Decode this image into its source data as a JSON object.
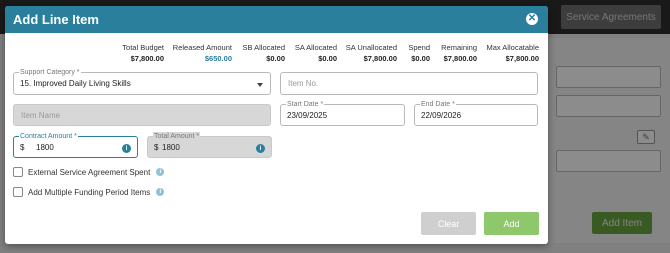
{
  "background": {
    "service_agreements_label": "Service Agreements",
    "add_item_label": "Add Item"
  },
  "modal": {
    "title": "Add Line Item",
    "close_icon": "close-icon"
  },
  "stats": [
    {
      "label": "Total Budget",
      "value": "$7,800.00"
    },
    {
      "label": "Released Amount",
      "value": "$650.00"
    },
    {
      "label": "SB Allocated",
      "value": "$0.00"
    },
    {
      "label": "SA Allocated",
      "value": "$0.00"
    },
    {
      "label": "SA Unallocated",
      "value": "$7,800.00"
    },
    {
      "label": "Spend",
      "value": "$0.00"
    },
    {
      "label": "Remaining",
      "value": "$7,800.00"
    },
    {
      "label": "Max Allocatable",
      "value": "$7,800.00"
    }
  ],
  "form": {
    "support_category": {
      "label": "Support Category *",
      "value": "15. Improved Daily Living Skills"
    },
    "item_no": {
      "placeholder": "Item No."
    },
    "item_name": {
      "placeholder": "Item Name"
    },
    "start_date": {
      "label": "Start Date *",
      "value": "23/09/2025"
    },
    "end_date": {
      "label": "End Date *",
      "value": "22/09/2026"
    },
    "contract_amount": {
      "label": "Contract Amount *",
      "currency": "$",
      "value": "1800"
    },
    "total_amount": {
      "label": "Total Amount *",
      "currency": "$",
      "value": "1800"
    },
    "external_spent_label": "External Service Agreement Spent",
    "multiple_funding_label": "Add Multiple Funding Period Items"
  },
  "buttons": {
    "clear": "Clear",
    "add": "Add"
  },
  "colors": {
    "header": "#2a7f9c",
    "add_button": "#8fc86a",
    "clear_button": "#cfcfcf",
    "accent": "#2a7f9c"
  }
}
